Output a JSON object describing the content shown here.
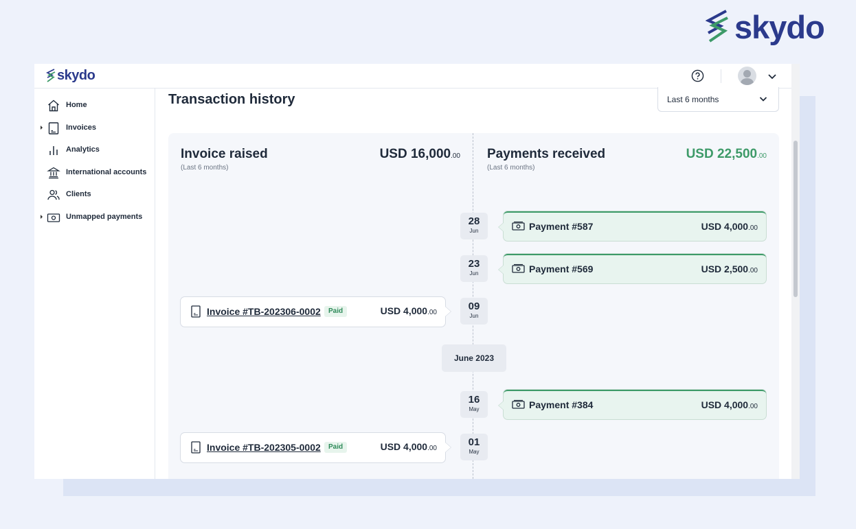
{
  "brand": {
    "name": "skydo",
    "color": "#2b3a8c",
    "accent": "#3d9a68"
  },
  "topbar": {
    "logo": "skydo",
    "help_icon": "help-circle-icon",
    "avatar_icon": "user-avatar",
    "menu_icon": "chevron-down-icon"
  },
  "sidebar": {
    "items": [
      {
        "label": "Home",
        "icon": "home-icon",
        "expandable": false
      },
      {
        "label": "Invoices",
        "icon": "invoice-icon",
        "expandable": true
      },
      {
        "label": "Analytics",
        "icon": "analytics-icon",
        "expandable": false
      },
      {
        "label": "International accounts",
        "icon": "bank-icon",
        "expandable": false
      },
      {
        "label": "Clients",
        "icon": "clients-icon",
        "expandable": false
      },
      {
        "label": "Unmapped payments",
        "icon": "cash-icon",
        "expandable": true
      }
    ]
  },
  "main": {
    "title": "Transaction history",
    "period_filter": "Last 6 months",
    "invoices": {
      "title": "Invoice raised",
      "subtitle": "(Last 6 months)",
      "total": "USD 16,000",
      "total_dec": ".00"
    },
    "payments": {
      "title": "Payments received",
      "subtitle": "(Last 6 months)",
      "total": "USD 22,500",
      "total_dec": ".00",
      "total_color": "#3d9a68"
    },
    "timeline": [
      {
        "day": "28",
        "month": "Jun"
      },
      {
        "day": "23",
        "month": "Jun"
      },
      {
        "day": "09",
        "month": "Jun"
      },
      {
        "day": "16",
        "month": "May"
      },
      {
        "day": "01",
        "month": "May"
      }
    ],
    "month_separator": "June 2023",
    "payment_entries": [
      {
        "label": "Payment #587",
        "amount": "USD 4,000",
        "dec": ".00"
      },
      {
        "label": "Payment #569",
        "amount": "USD 2,500",
        "dec": ".00"
      },
      {
        "label": "Payment #384",
        "amount": "USD 4,000",
        "dec": ".00"
      }
    ],
    "invoice_entries": [
      {
        "label": "Invoice #TB-202306-0002",
        "status": "Paid",
        "amount": "USD 4,000",
        "dec": ".00"
      },
      {
        "label": "Invoice #TB-202305-0002",
        "status": "Paid",
        "amount": "USD 4,000",
        "dec": ".00"
      }
    ]
  }
}
